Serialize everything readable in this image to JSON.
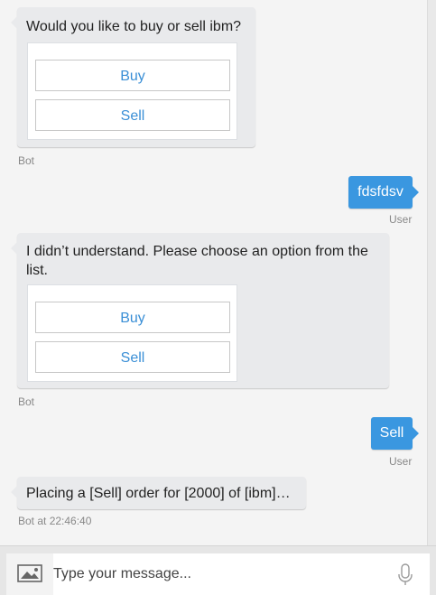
{
  "messages": {
    "bot1": {
      "text": "Would you like to buy or sell ibm?",
      "options": [
        "Buy",
        "Sell"
      ],
      "meta": "Bot"
    },
    "user1": {
      "text": "fdsfdsv",
      "meta": "User"
    },
    "bot2": {
      "text": "I didn’t understand. Please choose an option from the list.",
      "options": [
        "Buy",
        "Sell"
      ],
      "meta": "Bot"
    },
    "user2": {
      "text": "Sell",
      "meta": "User"
    },
    "bot3": {
      "text": "Placing a [Sell] order for [2000] of [ibm]…",
      "meta": "Bot at 22:46:40"
    }
  },
  "composer": {
    "placeholder": "Type your message...",
    "image_icon": "image-icon",
    "mic_icon": "microphone-icon"
  },
  "colors": {
    "accent": "#3a97e0",
    "option_text": "#3a8fd6",
    "bot_bubble": "#e9eaec",
    "background": "#f4f4f4"
  }
}
